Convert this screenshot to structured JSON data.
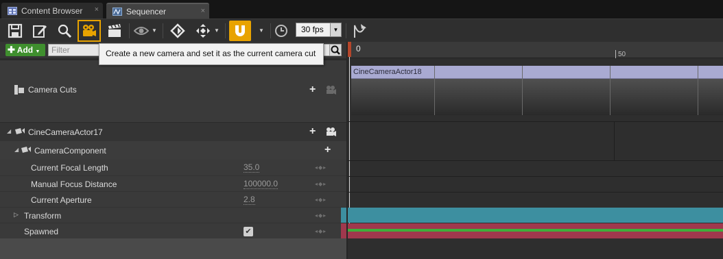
{
  "tabs": [
    {
      "label": "Content Browser",
      "icon": "content-browser-icon",
      "close": "×"
    },
    {
      "label": "Sequencer",
      "icon": "sequencer-icon",
      "close": "×"
    }
  ],
  "toolbar": {
    "buttons": [
      {
        "name": "save",
        "icon": "save-icon"
      },
      {
        "name": "save-as",
        "icon": "save-as-icon"
      },
      {
        "name": "find-in-browser",
        "icon": "search-icon"
      },
      {
        "name": "create-camera",
        "icon": "camera-icon",
        "active": true
      },
      {
        "name": "render-movie",
        "icon": "clapperboard-icon"
      },
      {
        "name": "view-options",
        "icon": "eye-icon"
      },
      {
        "name": "key-icon",
        "icon": "diamond-key-icon"
      },
      {
        "name": "transform-keys",
        "icon": "move-arrows-icon"
      },
      {
        "name": "snapping",
        "icon": "magnet-icon",
        "active": true
      },
      {
        "name": "play-rate",
        "icon": "clock-icon"
      },
      {
        "name": "curve-editor",
        "icon": "curve-icon"
      }
    ],
    "fps_value": "30 fps",
    "accent": "#e8a300"
  },
  "tooltip": {
    "text": "Create a new camera and set it as the current camera cut"
  },
  "filter": {
    "add_label": "Add",
    "search_placeholder": "Filter"
  },
  "tracks": {
    "camera_cuts": {
      "label": "Camera Cuts"
    },
    "camera_actor": {
      "label": "CineCameraActor17"
    },
    "camera_component": {
      "label": "CameraComponent"
    },
    "properties": [
      {
        "label": "Current Focal Length",
        "value": "35.0"
      },
      {
        "label": "Manual Focus Distance",
        "value": "100000.0"
      },
      {
        "label": "Current Aperture",
        "value": "2.8"
      }
    ],
    "transform": {
      "label": "Transform"
    },
    "spawned": {
      "label": "Spawned",
      "checked": true
    }
  },
  "timeline": {
    "ticks": [
      "0",
      "50"
    ],
    "cut_section_label": "CineCameraActor18",
    "colors": {
      "transform": "#3d8fa0",
      "spawned": "#a0384d",
      "spawned_line": "#3fae3a",
      "playhead": "#d44a2b"
    }
  }
}
